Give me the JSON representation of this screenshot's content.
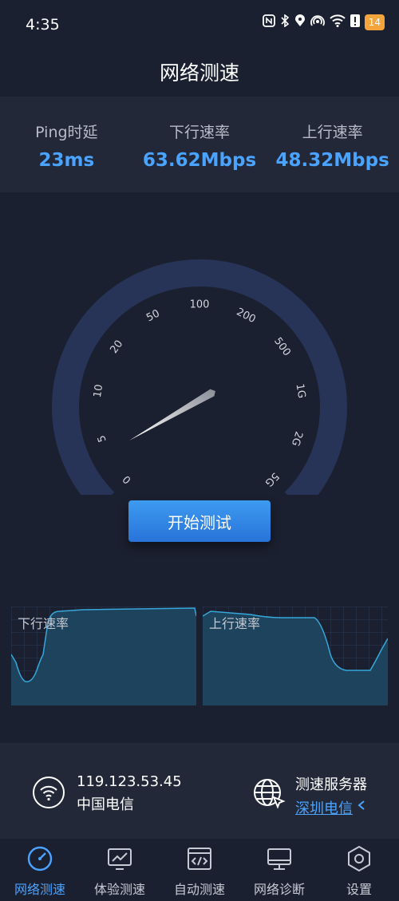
{
  "status_bar": {
    "time": "4:35",
    "battery": "14",
    "icons": [
      "nfc-icon",
      "bluetooth-icon",
      "location-icon",
      "hotspot-icon",
      "wifi-icon",
      "alert-icon",
      "battery-icon"
    ]
  },
  "header": {
    "title": "网络测速"
  },
  "stats": [
    {
      "label": "Ping时延",
      "value": "23ms"
    },
    {
      "label": "下行速率",
      "value": "63.62Mbps"
    },
    {
      "label": "上行速率",
      "value": "48.32Mbps"
    }
  ],
  "gauge": {
    "ticks": [
      "0",
      "5",
      "10",
      "20",
      "50",
      "100",
      "200",
      "500",
      "1G",
      "2G",
      "5G"
    ],
    "needle_tick_position": 2.5
  },
  "start_button": {
    "label": "开始测试"
  },
  "graphs": {
    "download_label": "下行速率",
    "upload_label": "上行速率"
  },
  "network": {
    "ip": "119.123.53.45",
    "isp": "中国电信"
  },
  "server": {
    "title": "测速服务器",
    "name": "深圳电信"
  },
  "tabbar": {
    "items": [
      {
        "label": "网络测速",
        "icon": "speedometer-icon",
        "active": true
      },
      {
        "label": "体验测速",
        "icon": "monitor-chart-icon",
        "active": false
      },
      {
        "label": "自动测速",
        "icon": "code-window-icon",
        "active": false
      },
      {
        "label": "网络诊断",
        "icon": "desktop-icon",
        "active": false
      },
      {
        "label": "设置",
        "icon": "hexagon-settings-icon",
        "active": false
      }
    ]
  },
  "colors": {
    "accent": "#4aa3ff",
    "background": "#1b2030",
    "panel": "#222838",
    "battery": "#f3a43a"
  }
}
